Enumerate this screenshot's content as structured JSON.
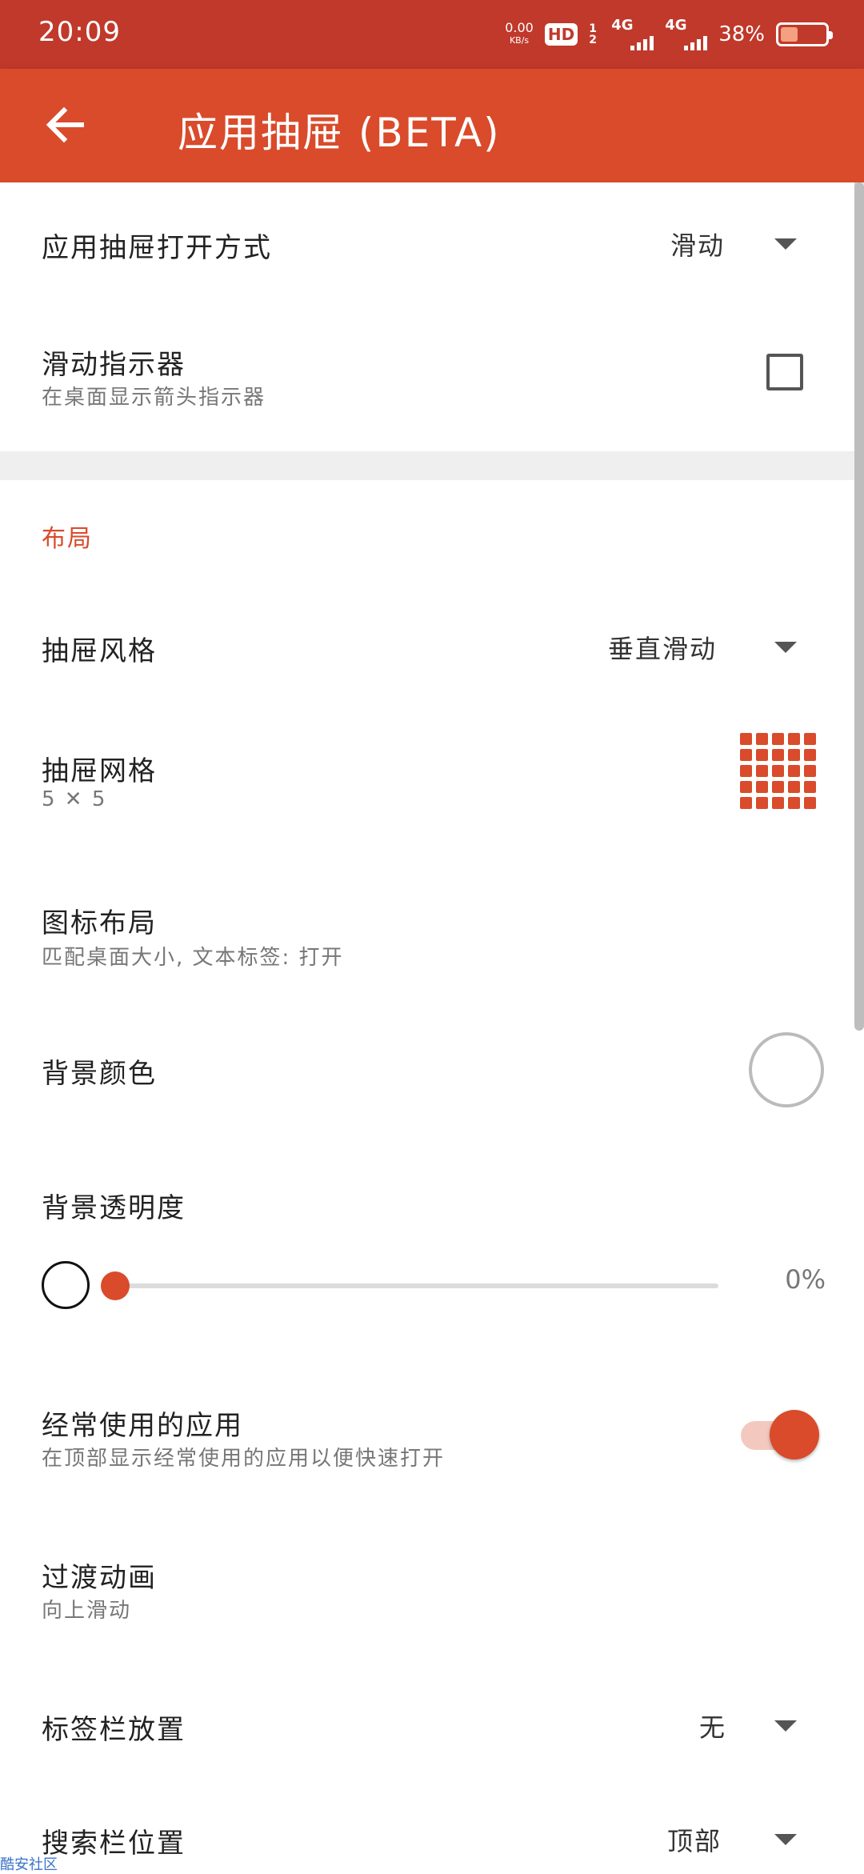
{
  "status_bar": {
    "time": "20:09",
    "net_speed_value": "0.00",
    "net_speed_unit": "KB/s",
    "hd_label": "HD",
    "hd_sub": "1 2",
    "signal1_label": "4G",
    "signal2_label": "4G",
    "battery_percent": "38%",
    "battery_level": 0.38
  },
  "app_bar": {
    "back_icon": "arrow-back-icon",
    "title": "应用抽屉 (BETA)"
  },
  "settings": {
    "open_method": {
      "title": "应用抽屉打开方式",
      "value": "滑动"
    },
    "swipe_indicator": {
      "title": "滑动指示器",
      "subtitle": "在桌面显示箭头指示器",
      "checked": false
    },
    "section_layout": "布局",
    "drawer_style": {
      "title": "抽屉风格",
      "value": "垂直滑动"
    },
    "drawer_grid": {
      "title": "抽屉网格",
      "subtitle": "5 ✕ 5",
      "columns": 5,
      "rows": 5
    },
    "icon_layout": {
      "title": "图标布局",
      "subtitle": "匹配桌面大小, 文本标签: 打开"
    },
    "bg_color": {
      "title": "背景颜色"
    },
    "bg_transparency": {
      "title": "背景透明度",
      "value_label": "0%",
      "value": 0
    },
    "frequent_apps": {
      "title": "经常使用的应用",
      "subtitle": "在顶部显示经常使用的应用以便快速打开",
      "enabled": true
    },
    "transition": {
      "title": "过渡动画",
      "subtitle": "向上滑动"
    },
    "tab_bar": {
      "title": "标签栏放置",
      "value": "无"
    },
    "search_bar": {
      "title": "搜索栏位置",
      "value": "顶部"
    }
  },
  "watermark": "酷安社区",
  "colors": {
    "status_bar": "#c0392b",
    "app_bar": "#d94b2b",
    "accent": "#d94b2b"
  }
}
